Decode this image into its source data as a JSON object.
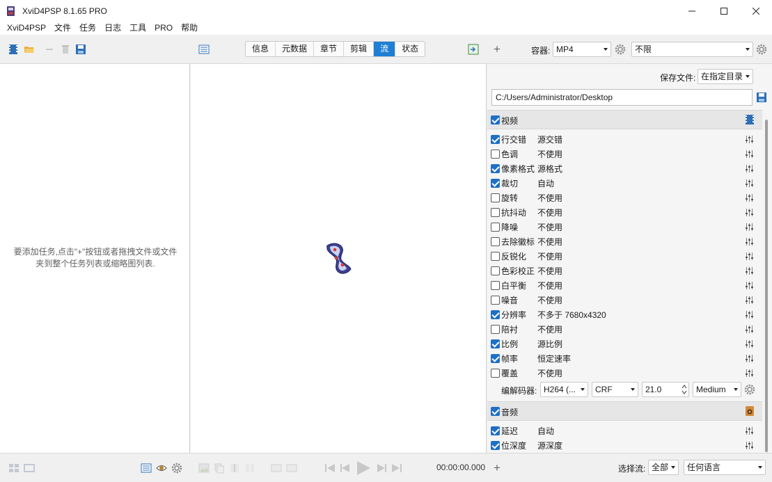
{
  "window": {
    "title": "XviD4PSP 8.1.65 PRO",
    "controls": [
      "minimize-icon",
      "maximize-icon",
      "close-icon"
    ]
  },
  "menu": [
    "XviD4PSP",
    "文件",
    "任务",
    "日志",
    "工具",
    "PRO",
    "帮助"
  ],
  "toolbar": {
    "tabs": [
      "信息",
      "元数据",
      "章节",
      "剪辑",
      "流",
      "状态"
    ],
    "active_tab": "流",
    "add_symbol": "+",
    "container_label": "容器:",
    "container_value": "MP4",
    "limit_value": "不限"
  },
  "left": {
    "hint_line1": "要添加任务,点击\"+\"按钮或者拖拽文件或文件",
    "hint_line2": "夹到整个任务列表或缩略图列表."
  },
  "right": {
    "save_label": "保存文件:",
    "save_mode": "在指定目录",
    "path": "C:/Users/Administrator/Desktop",
    "video": {
      "title": "视频",
      "checked": true,
      "rows": [
        {
          "label": "行交错",
          "value": "源交错",
          "checked": true
        },
        {
          "label": "色调",
          "value": "不使用",
          "checked": false
        },
        {
          "label": "像素格式",
          "value": "源格式",
          "checked": true
        },
        {
          "label": "裁切",
          "value": "自动",
          "checked": true
        },
        {
          "label": "旋转",
          "value": "不使用",
          "checked": false
        },
        {
          "label": "抗抖动",
          "value": "不使用",
          "checked": false
        },
        {
          "label": "降噪",
          "value": "不使用",
          "checked": false
        },
        {
          "label": "去除徽标",
          "value": "不使用",
          "checked": false
        },
        {
          "label": "反锐化",
          "value": "不使用",
          "checked": false
        },
        {
          "label": "色彩校正",
          "value": "不使用",
          "checked": false
        },
        {
          "label": "白平衡",
          "value": "不使用",
          "checked": false
        },
        {
          "label": "噪音",
          "value": "不使用",
          "checked": false
        },
        {
          "label": "分辨率",
          "value": "不多于 7680x4320",
          "checked": true
        },
        {
          "label": "陪衬",
          "value": "不使用",
          "checked": false
        },
        {
          "label": "比例",
          "value": "源比例",
          "checked": true
        },
        {
          "label": "帧率",
          "value": "恒定速率",
          "checked": true
        },
        {
          "label": "覆盖",
          "value": "不使用",
          "checked": false
        }
      ],
      "encoder_label": "编解码器:",
      "codec": "H264 (...",
      "rate_mode": "CRF",
      "quality": "21.0",
      "preset": "Medium"
    },
    "audio": {
      "title": "音频",
      "checked": true,
      "rows": [
        {
          "label": "延迟",
          "value": "自动",
          "checked": true
        },
        {
          "label": "位深度",
          "value": "源深度",
          "checked": true
        }
      ]
    }
  },
  "bottom": {
    "timecode": "00:00:00.000",
    "add_symbol": "+",
    "stream_label": "选择流:",
    "stream_value": "全部",
    "language_value": "任何语言"
  }
}
